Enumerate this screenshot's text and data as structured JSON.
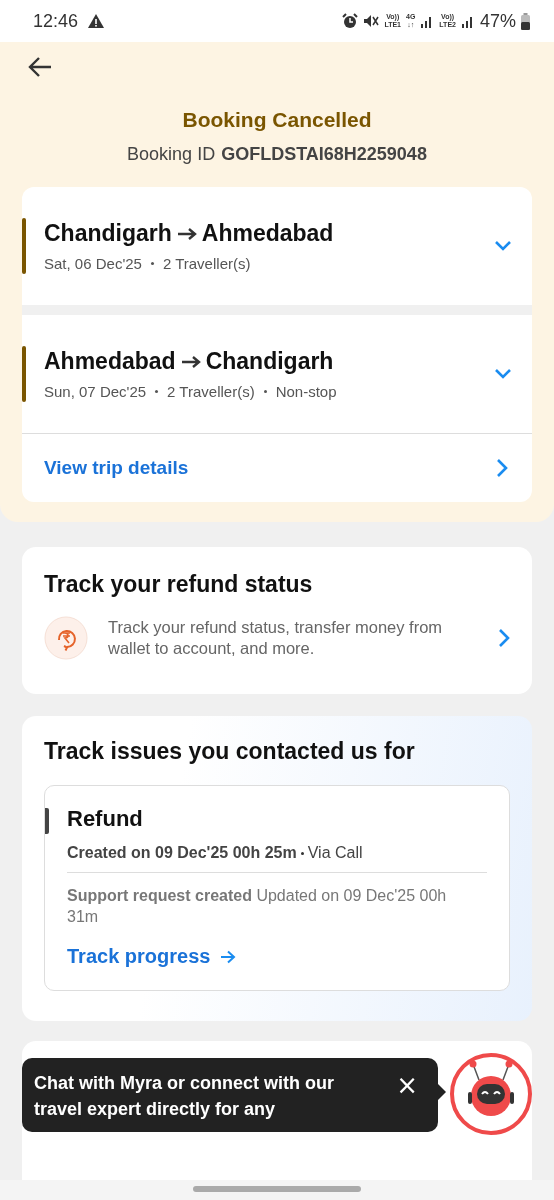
{
  "status_bar": {
    "time": "12:46",
    "network_labels": [
      {
        "top": "Vo))",
        "bottom": "LTE1"
      },
      {
        "top": "4G",
        "bottom": "↓↑"
      },
      {
        "top": "Vo))",
        "bottom": "LTE2"
      }
    ],
    "battery": "47%"
  },
  "header": {
    "title": "Booking Cancelled",
    "booking_id_label": "Booking ID",
    "booking_id": "GOFLDSTAI68H2259048"
  },
  "trips": [
    {
      "from": "Chandigarh",
      "to": "Ahmedabad",
      "details": [
        "Sat, 06 Dec'25",
        "2 Traveller(s)"
      ],
      "expanded": false
    },
    {
      "from": "Ahmedabad",
      "to": "Chandigarh",
      "details": [
        "Sun, 07 Dec'25",
        "2 Traveller(s)",
        "Non-stop"
      ],
      "expanded": false
    }
  ],
  "view_trip_details": "View trip details",
  "refund_card": {
    "title": "Track your refund status",
    "description": "Track your refund status, transfer money from wallet to account, and more."
  },
  "issues_card": {
    "title": "Track issues you contacted us for",
    "issue": {
      "title": "Refund",
      "created": "Created on 09 Dec'25 00h 25m",
      "channel": "Via Call",
      "status": "**Support request created** Updated on 09 Dec'25 00h 31m",
      "action": "Track progress"
    }
  },
  "chat_tooltip": {
    "text": "Chat with Myra or connect with our travel expert directly for any",
    "close": "×"
  }
}
